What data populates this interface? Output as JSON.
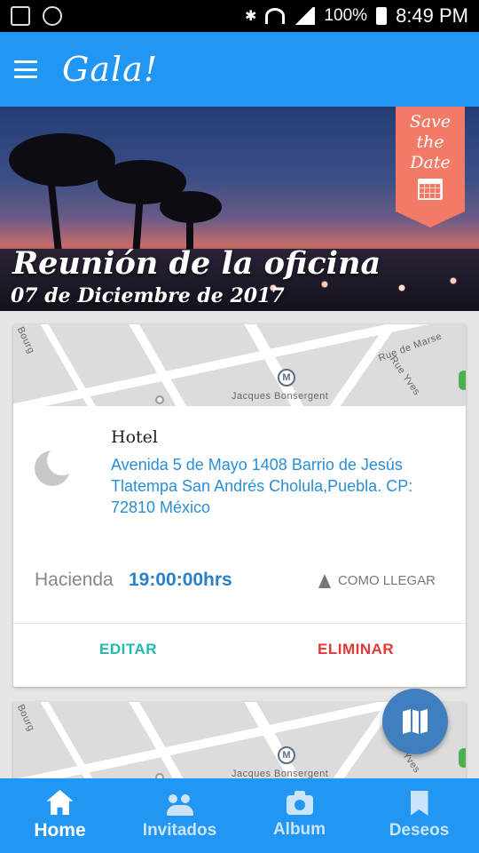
{
  "status_bar": {
    "battery": "100%",
    "time": "8:49 PM",
    "icons": [
      "gallery-icon",
      "sync-icon",
      "bluetooth-icon",
      "wifi-icon",
      "signal-icon",
      "battery-icon"
    ]
  },
  "app_bar": {
    "logo": "Gala!",
    "menu_icon": "hamburger-menu-icon",
    "color": "#2196f3"
  },
  "event": {
    "title": "Reunión de la oficina",
    "date": "07 de Diciembre de 2017",
    "save_the_date": [
      "Save",
      "the",
      "Date"
    ],
    "save_date_color": "#f27a66"
  },
  "locations": [
    {
      "map_labels": [
        "Jacques Bonsergent",
        "Rue de Marse",
        "Rue Yves",
        "Bourg"
      ],
      "icon": "moon-icon",
      "type": "Hotel",
      "address": "Avenida 5 de Mayo 1408 Barrio de Jesús Tlatempa San Andrés Cholula,Puebla. CP: 72810 México",
      "venue": "Hacienda",
      "time": "19:00:00hrs",
      "directions_label": "COMO LLEGAR",
      "edit_label": "EDITAR",
      "delete_label": "ELIMINAR"
    },
    {
      "map_labels": [
        "Jacques Bonsergent",
        "Rue Yves",
        "Bourg"
      ]
    }
  ],
  "fab": {
    "icon": "map-icon",
    "color": "#3f7fbf"
  },
  "bottom_nav": {
    "items": [
      {
        "label": "Home",
        "icon": "home-icon",
        "active": true
      },
      {
        "label": "Invitados",
        "icon": "people-icon",
        "active": false
      },
      {
        "label": "Album",
        "icon": "camera-icon",
        "active": false
      },
      {
        "label": "Deseos",
        "icon": "bookmark-icon",
        "active": false
      }
    ]
  }
}
